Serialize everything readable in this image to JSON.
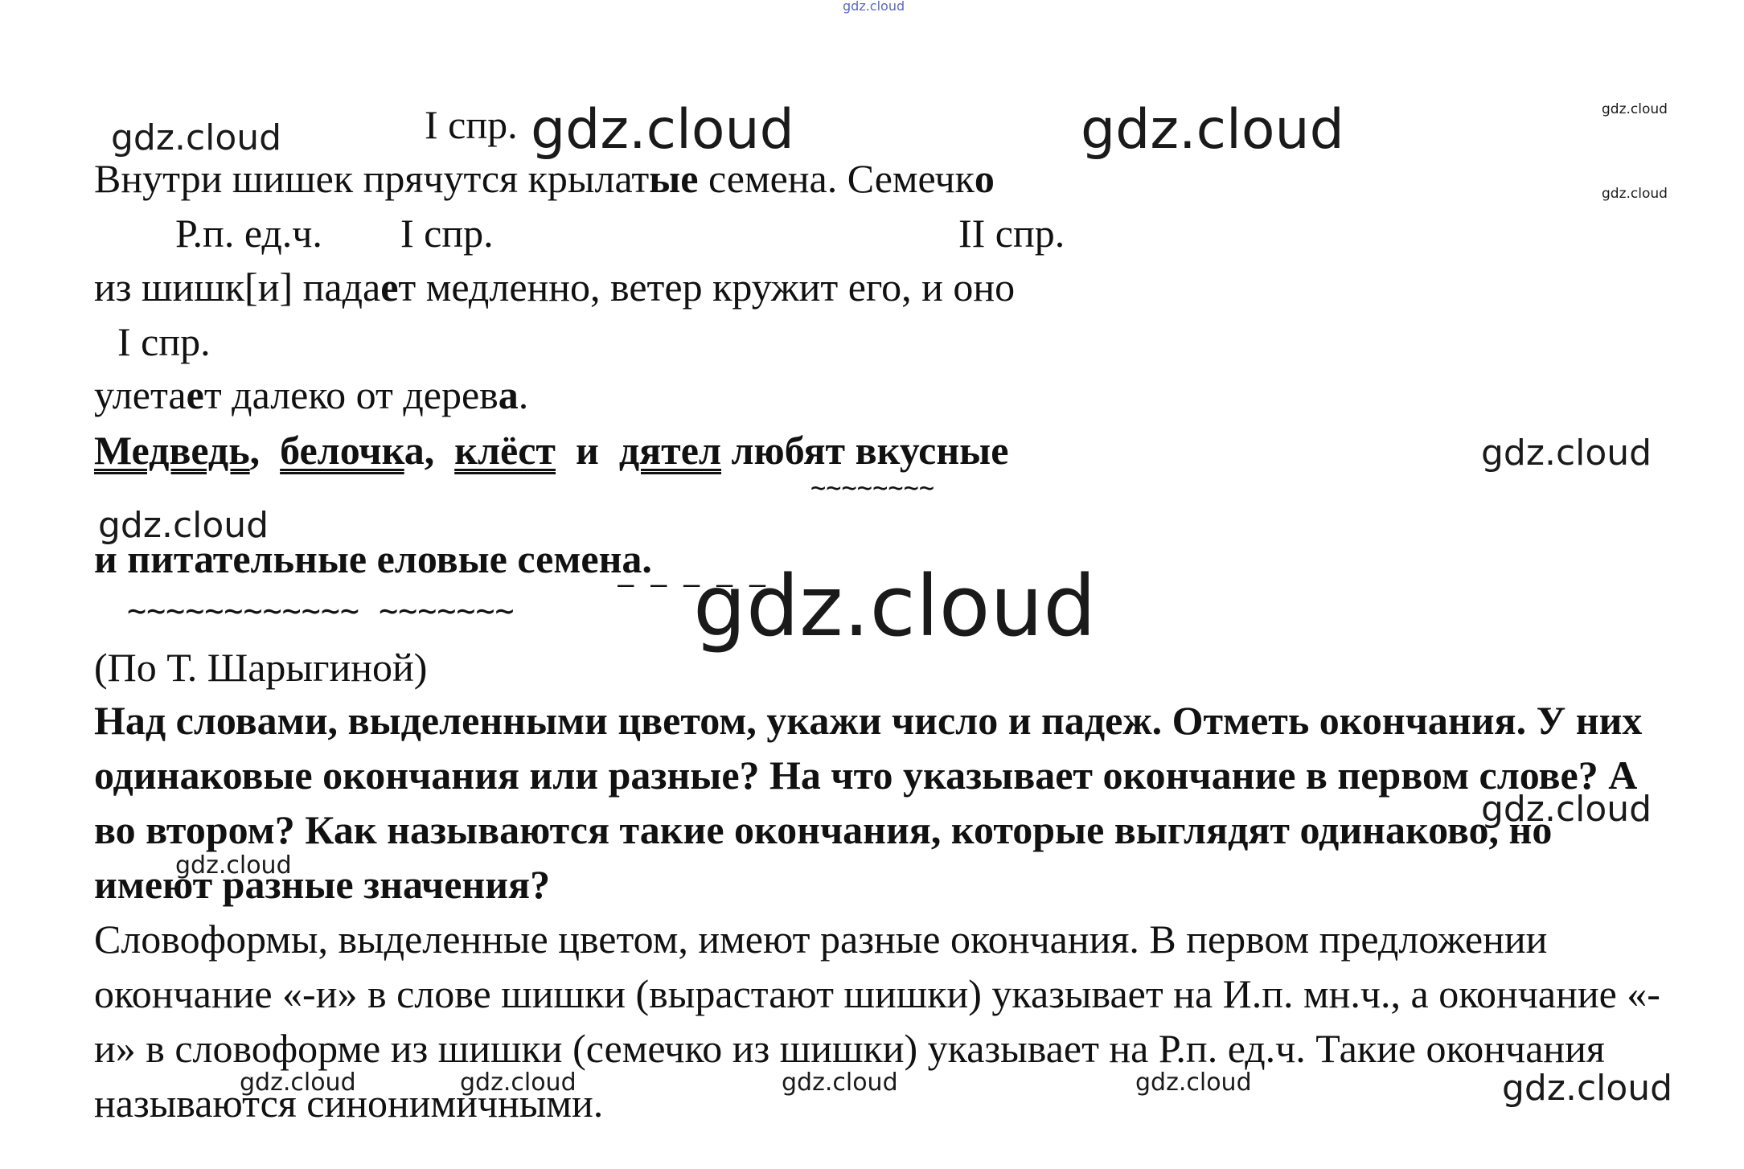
{
  "watermark": "gdz.cloud",
  "annotations": {
    "a1": "I спр.",
    "a2": "Р.п. ед.ч.",
    "a3": "I спр.",
    "a4": "II спр.",
    "a5": "I спр."
  },
  "text": {
    "line1": [
      "Внутри  шишек  прячутся  крылат",
      "ые",
      " семена.  Семечк",
      "о"
    ],
    "line2": [
      "из шишк[и] пада",
      "е",
      "т медленно, ветер кружит его,  и  оно"
    ],
    "line3": [
      "улета",
      "е",
      "т далеко от дерев",
      "а",
      "."
    ],
    "line4": {
      "w1": "Медведь",
      "s1": ",  ",
      "w2": "белочк",
      "w2_end": "а",
      "s2": ",  ",
      "w3": "клёст",
      "s3": "  и  ",
      "w4": "дятел",
      "s4": " любят вкусные"
    },
    "line5": "и питательные еловые семена.",
    "wavy1": "~~~~~~~~",
    "wavy2": "~~~~~~~~~~~~ ~~~~~~~",
    "dashes": "– – – – –",
    "author": "(По Т. Шарыгиной)",
    "task": "Над словами, выделенными цветом, укажи число и падеж. Отметь окончания. У них одинаковые окончания или разные? На что указывает окончание в первом слове? А во втором? Как называются такие окончания, которые выглядят одинаково, но имеют разные значения?",
    "answer": "Словоформы, выделенные цветом, имеют разные окончания. В первом предложении окончание «-и» в слове шишки (вырастают шишки) указывает на И.п. мн.ч., а окончание «-и» в словоформе из шишки (семечко из шишки) указывает на Р.п. ед.ч. Такие окончания называются синонимичными."
  }
}
